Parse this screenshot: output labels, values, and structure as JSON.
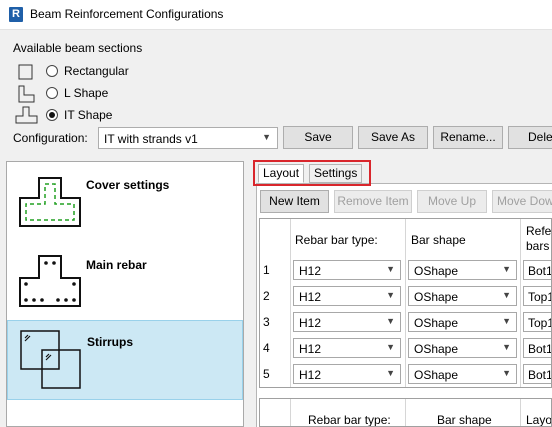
{
  "window": {
    "app_icon_letter": "R",
    "title": "Beam Reinforcement Configurations"
  },
  "sections": {
    "label": "Available beam sections",
    "options": [
      {
        "label": "Rectangular",
        "icon": "rectangular-section-icon",
        "checked": false
      },
      {
        "label": "L Shape",
        "icon": "l-shape-section-icon",
        "checked": false
      },
      {
        "label": "IT Shape",
        "icon": "it-shape-section-icon",
        "checked": true
      }
    ]
  },
  "configuration": {
    "label": "Configuration:",
    "value": "IT with strands v1",
    "buttons": {
      "save": "Save",
      "save_as": "Save As",
      "rename": "Rename...",
      "delete": "Delet"
    }
  },
  "left_panel": {
    "items": [
      {
        "label": "Cover settings",
        "icon": "cover-settings-icon",
        "selected": false
      },
      {
        "label": "Main rebar",
        "icon": "main-rebar-icon",
        "selected": false
      },
      {
        "label": "Stirrups",
        "icon": "stirrups-icon",
        "selected": true
      }
    ]
  },
  "tabs": {
    "layout": "Layout",
    "settings": "Settings",
    "active": "Layout"
  },
  "toolbar": {
    "new_item": "New Item",
    "remove_item": "Remove Item",
    "move_up": "Move Up",
    "move_down": "Move Dow"
  },
  "main_grid": {
    "headers": {
      "rebar_bar_type": "Rebar bar type:",
      "bar_shape": "Bar shape",
      "reference_line1": "Refer",
      "reference_line2": "bars"
    },
    "rows": [
      {
        "num": "1",
        "bar_type": "H12",
        "shape": "OShape",
        "ref": "Bot1"
      },
      {
        "num": "2",
        "bar_type": "H12",
        "shape": "OShape",
        "ref": "Top1"
      },
      {
        "num": "3",
        "bar_type": "H12",
        "shape": "OShape",
        "ref": "Top1"
      },
      {
        "num": "4",
        "bar_type": "H12",
        "shape": "OShape",
        "ref": "Bot1"
      },
      {
        "num": "5",
        "bar_type": "H12",
        "shape": "OShape",
        "ref": "Bot1"
      }
    ]
  },
  "second_grid": {
    "headers": {
      "rebar_bar_type": "Rebar bar type:",
      "bar_shape": "Bar shape",
      "layout": "Layou"
    }
  },
  "colors": {
    "selected_row": "#cce8f4",
    "highlight_border": "#d9262c",
    "cover_line": "#22a022"
  }
}
